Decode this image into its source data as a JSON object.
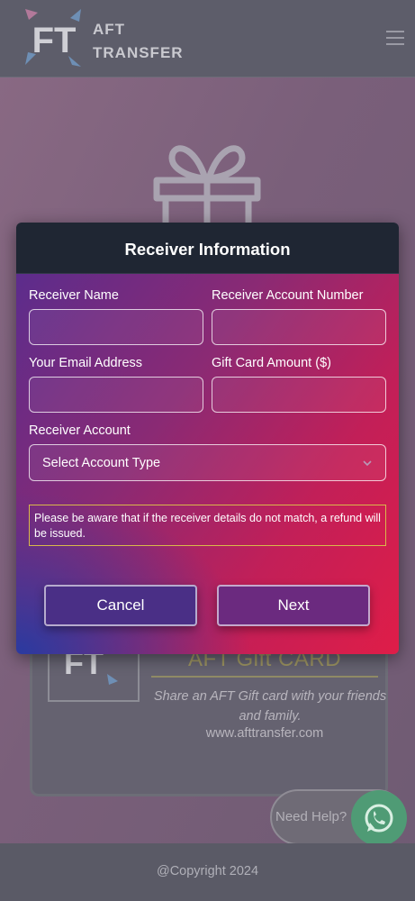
{
  "header": {
    "logo_initials": "FT",
    "logo_text_line1": "AFT",
    "logo_text_line2": "TRANSFER",
    "icons": {
      "menu": "hamburger-menu-icon",
      "illustration": "gift-box-icon"
    }
  },
  "gift_card": {
    "logo_initials": "FT",
    "title": "AFT Gift CARD",
    "description": "Share an AFT Gift card with your friends and family.",
    "url": "www.afttransfer.com"
  },
  "help": {
    "label": "Need Help?",
    "icon": "whatsapp-icon"
  },
  "footer": {
    "copyright": "@Copyright 2024"
  },
  "modal": {
    "title": "Receiver Information",
    "fields": {
      "receiver_name": {
        "label": "Receiver Name",
        "value": ""
      },
      "receiver_account_number": {
        "label": "Receiver Account Number",
        "value": ""
      },
      "email": {
        "label": "Your Email Address",
        "value": ""
      },
      "amount": {
        "label": "Gift Card Amount ($)",
        "value": ""
      },
      "receiver_account": {
        "label": "Receiver Account",
        "selected": "Select Account Type"
      }
    },
    "notice": "Please be aware that if the receiver details do not match, a refund will be issued.",
    "buttons": {
      "cancel": "Cancel",
      "next": "Next"
    }
  },
  "colors": {
    "modal_header": "#1f2633",
    "gradient_start": "#5c2c8c",
    "gradient_end": "#df1d48",
    "notice_border": "#d8b94a",
    "whatsapp": "#4f9b75"
  }
}
